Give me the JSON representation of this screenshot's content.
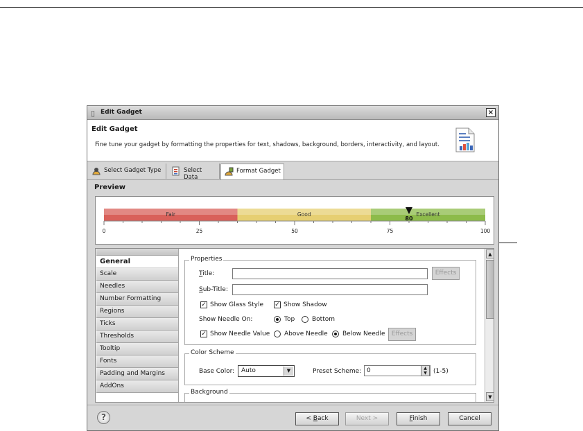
{
  "dialog": {
    "window_title": "Edit Gadget",
    "header_title": "Edit Gadget",
    "header_desc": "Fine tune your gadget by formatting the properties for text, shadows, background, borders, interactivity, and layout."
  },
  "tabs": [
    {
      "label": "Select Gadget Type",
      "icon": "gadget-type-icon"
    },
    {
      "label": "Select Data",
      "icon": "data-icon"
    },
    {
      "label": "Format Gadget",
      "icon": "format-icon",
      "active": true
    }
  ],
  "preview": {
    "label": "Preview",
    "regions": [
      {
        "label": "Fair",
        "from": 0,
        "to": 35,
        "color": "#d9605a"
      },
      {
        "label": "Good",
        "from": 35,
        "to": 70,
        "color": "#e6cf72"
      },
      {
        "label": "Excellent",
        "from": 70,
        "to": 100,
        "color": "#8dbb4a"
      }
    ],
    "needle_value": "80",
    "needle": 80,
    "ticks": [
      "0",
      "25",
      "50",
      "75",
      "100"
    ]
  },
  "nav": {
    "items": [
      "General",
      "Scale",
      "Needles",
      "Number Formatting",
      "Regions",
      "Ticks",
      "Thresholds",
      "Tooltip",
      "Fonts",
      "Padding and Margins",
      "AddOns"
    ],
    "selected": 0
  },
  "properties": {
    "group_label": "Properties",
    "title_label": "Title:",
    "title_mnemonic": "T",
    "title_rest": "itle:",
    "title_value": "",
    "effects_label": "Effects",
    "subtitle_mnemonic": "S",
    "subtitle_rest": "ub-Title:",
    "subtitle_value": "",
    "show_glass_label": "Show Glass Style",
    "show_shadow_label": "Show Shadow",
    "needle_on_label": "Show Needle On:",
    "top_label": "Top",
    "bottom_label": "Bottom",
    "show_needle_value_label": "Show Needle Value",
    "above_label": "Above Needle",
    "below_label": "Below Needle",
    "effects2_label": "Effects"
  },
  "color_scheme": {
    "group_label": "Color Scheme",
    "base_color_label": "Base Color:",
    "base_color_value": "Auto",
    "preset_label": "Preset Scheme:",
    "preset_value": "0",
    "range_label": "(1-5)"
  },
  "background": {
    "group_label": "Background"
  },
  "footer": {
    "help": "?",
    "back_mnemonic": "B",
    "back_prefix": "< ",
    "back_rest": "ack",
    "next": "Next >",
    "finish_mnemonic": "F",
    "finish_rest": "inish",
    "cancel": "Cancel"
  }
}
